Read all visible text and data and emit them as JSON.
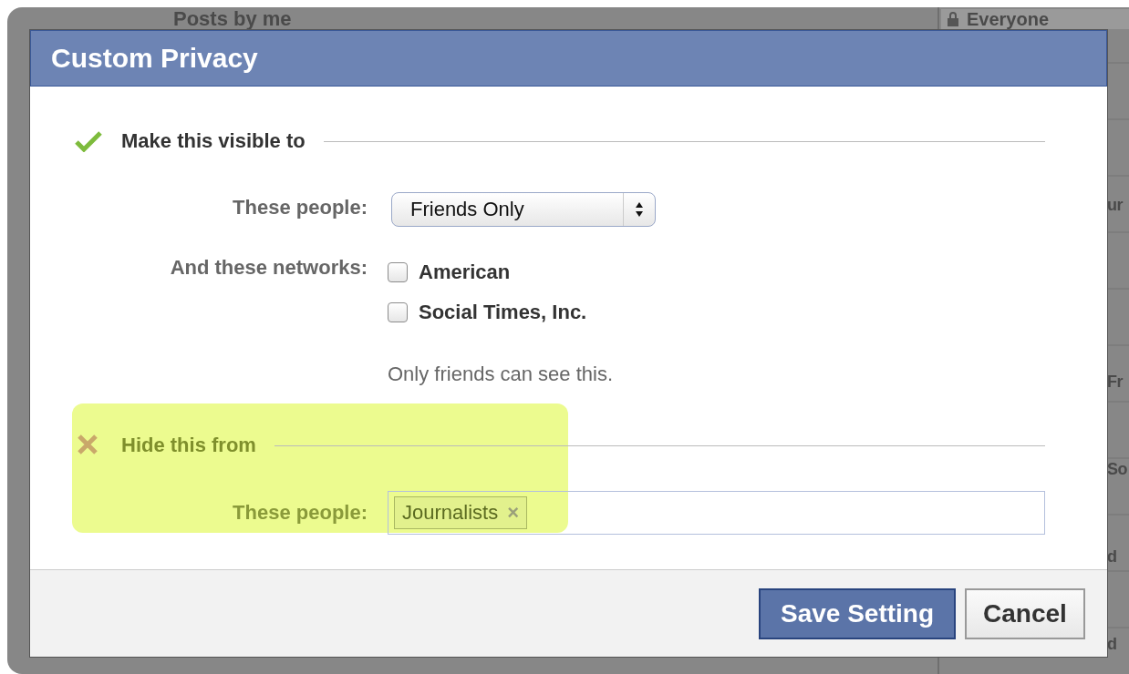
{
  "background": {
    "top_text": "Posts by me",
    "privacy_button": {
      "label": "Everyone"
    },
    "column_texts": [
      "ur",
      "Fr",
      "So",
      "d",
      "d"
    ]
  },
  "dialog": {
    "title": "Custom Privacy",
    "visible_section": {
      "heading": "Make this visible to",
      "people_label": "These people:",
      "people_select": {
        "value": "Friends Only"
      },
      "networks_label": "And these networks:",
      "networks": [
        {
          "label": "American",
          "checked": false
        },
        {
          "label": "Social Times, Inc.",
          "checked": false
        }
      ],
      "note": "Only friends can see this."
    },
    "hide_section": {
      "heading": "Hide this from",
      "highlighted": true,
      "people_label": "These people:",
      "tokens": [
        {
          "label": "Journalists",
          "remove": "×"
        }
      ]
    },
    "buttons": [
      {
        "label": "Save Setting",
        "kind": "primary"
      },
      {
        "label": "Cancel",
        "kind": "secondary"
      }
    ]
  }
}
